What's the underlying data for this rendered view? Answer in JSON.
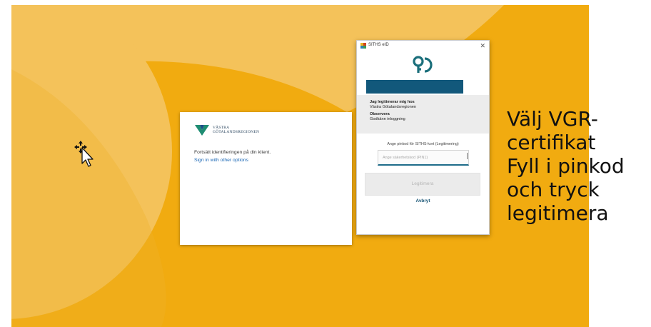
{
  "colors": {
    "desktop": "#f1ab10",
    "desktop_shape_light": "#f4c25a",
    "siths_accent": "#12587b",
    "link": "#1a67b5"
  },
  "signin": {
    "logo_text": [
      "VÄSTRA",
      "GÖTALANDSREGIONEN"
    ],
    "continue_text": "Fortsätt identifieringen på din klient.",
    "other_options_link": "Sign in with other options"
  },
  "siths": {
    "title": "SITHS eID",
    "close_icon": "close-icon",
    "heading": "Jag legitimerar mig hos",
    "organization": "Västra Götalandsregionen",
    "notice_heading": "Observera",
    "notice_text": "Godkänn inloggning",
    "pin_label": "Ange pinkod för SITHS-kort (Legitimering)",
    "pin_placeholder": "Ange säkerhetskod (PIN1)",
    "legitimera_button": "Legitimera",
    "cancel_link": "Avbryt"
  },
  "instructions": [
    "Välj VGR-",
    "certifikat",
    "Fyll i pinkod",
    "och tryck",
    "legitimera"
  ]
}
